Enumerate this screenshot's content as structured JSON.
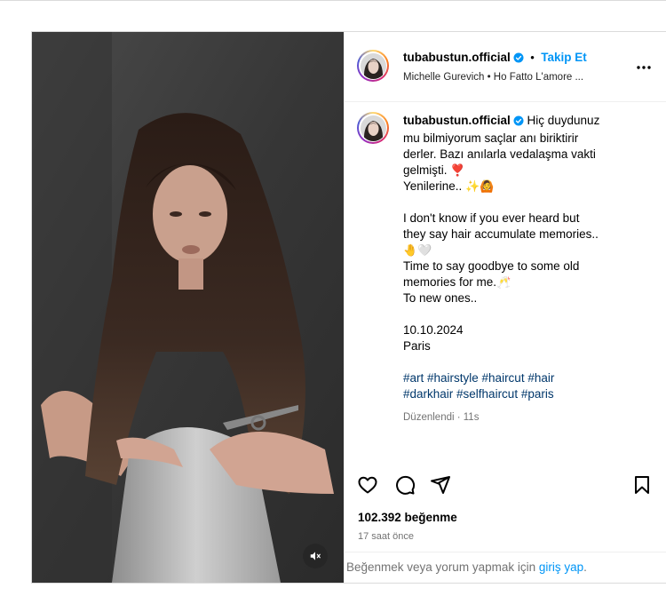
{
  "post": {
    "username": "tubabustun.official",
    "follow_label": "Takip Et",
    "separator": "•",
    "audio": "Michelle Gurevich • Ho Fatto L'amore ...",
    "caption": {
      "line1": "Hiç duydunuz",
      "line2": "mu bilmiyorum saçlar anı biriktirir",
      "line3": "derler. Bazı anılarla vedalaşma vakti",
      "line4": "gelmişti.",
      "line4_emoji": "❣️",
      "line5": "Yenilerine..",
      "line5_emoji": "✨🙆",
      "line6": "I don't know if you ever heard but",
      "line7": "they say hair accumulate memories..",
      "line8_emoji": "🤚🤍",
      "line9": "Time to say goodbye to some old",
      "line10": "memories for me.",
      "line10_emoji": "🥂",
      "line11": "To new ones..",
      "date": "10.10.2024",
      "place": "Paris",
      "hashtags_line1": "#art #hairstyle #haircut #hair",
      "hashtags_line2": "#darkhair #selfhaircut #paris",
      "edited": "Düzenlendi · 11s"
    },
    "likes": "102.392 beğenme",
    "time_ago": "17 saat önce",
    "footer_text": "Beğenmek veya yorum yapmak için ",
    "footer_link": "giriş yap",
    "footer_end": "."
  },
  "icons": {
    "like": "heart-icon",
    "comment": "comment-icon",
    "share": "share-icon",
    "save": "bookmark-icon",
    "more": "more-icon",
    "mute": "speaker-muted-icon",
    "verified": "verified-badge-icon"
  },
  "colors": {
    "accent": "#0095f6",
    "hashtag": "#00376b",
    "muted_text": "#737373",
    "border": "#dbdbdb"
  }
}
